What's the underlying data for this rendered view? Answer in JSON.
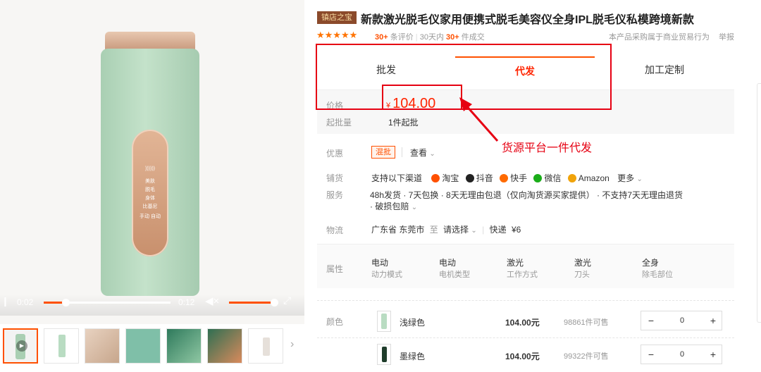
{
  "media": {
    "device_panel_lines": [
      "))))))",
      "美肤",
      "脱毛",
      "身体",
      "比基尼",
      "手动  自动"
    ],
    "video": {
      "current_time": "0:02",
      "total_time": "0:12",
      "progress": 0.17,
      "volume": 0.9
    },
    "thumbnails": [
      "video",
      "device-front",
      "usage-photo",
      "banner-green",
      "banner-1",
      "banner-2",
      "banner-3",
      "device-small"
    ]
  },
  "product": {
    "shop_badge": "镇店之宝",
    "title": "新款激光脱毛仪家用便携式脱毛美容仪全身IPL脱毛仪私模跨境新款",
    "rating_stars": 5,
    "review_count": "30+",
    "review_label": "条评价",
    "sales_period": "30天内",
    "sales_count": "30+",
    "sales_label": "件成交",
    "notice": "本产品采购属于商业贸易行为",
    "report": "举报"
  },
  "tabs": [
    {
      "label": "批发",
      "active": false
    },
    {
      "label": "代发",
      "active": true
    },
    {
      "label": "加工定制",
      "active": false
    }
  ],
  "price": {
    "label": "价格",
    "currency": "¥",
    "value": "104.00",
    "min_order_label": "起批量",
    "min_order_value": "1件起批"
  },
  "annotation": {
    "text": "货源平台一件代发",
    "color": "#e60012"
  },
  "promo": {
    "label": "优惠",
    "tag": "混批",
    "view": "查看"
  },
  "distribution": {
    "label": "铺货",
    "intro": "支持以下渠道",
    "channels": [
      {
        "name": "淘宝",
        "color": "#ff5000"
      },
      {
        "name": "抖音",
        "color": "#222222"
      },
      {
        "name": "快手",
        "color": "#ff6a00"
      },
      {
        "name": "微信",
        "color": "#1aad19"
      },
      {
        "name": "Amazon",
        "color": "#f0a30a"
      }
    ],
    "more": "更多"
  },
  "service": {
    "label": "服务",
    "line1": "48h发货 · 7天包换 · 8天无理由包退（仅向淘货源买家提供） · 不支持7天无理由退货",
    "line2": "· 破损包赔"
  },
  "logistics": {
    "label": "物流",
    "from": "广东省 东莞市",
    "to_label": "至",
    "to": "请选择",
    "method": "快递",
    "fee": "¥6"
  },
  "attributes": {
    "label": "属性",
    "items": [
      {
        "value": "电动",
        "key": "动力模式"
      },
      {
        "value": "电动",
        "key": "电机类型"
      },
      {
        "value": "激光",
        "key": "工作方式"
      },
      {
        "value": "激光",
        "key": "刀头"
      },
      {
        "value": "全身",
        "key": "除毛部位"
      }
    ]
  },
  "colors": {
    "label": "颜色",
    "items": [
      {
        "name": "浅绿色",
        "price": "104.00元",
        "stock": "98861件可售",
        "qty": "0",
        "swatch": "#b9dcc2"
      },
      {
        "name": "墨绿色",
        "price": "104.00元",
        "stock": "99322件可售",
        "qty": "0",
        "swatch": "#1f3d2b"
      }
    ]
  }
}
